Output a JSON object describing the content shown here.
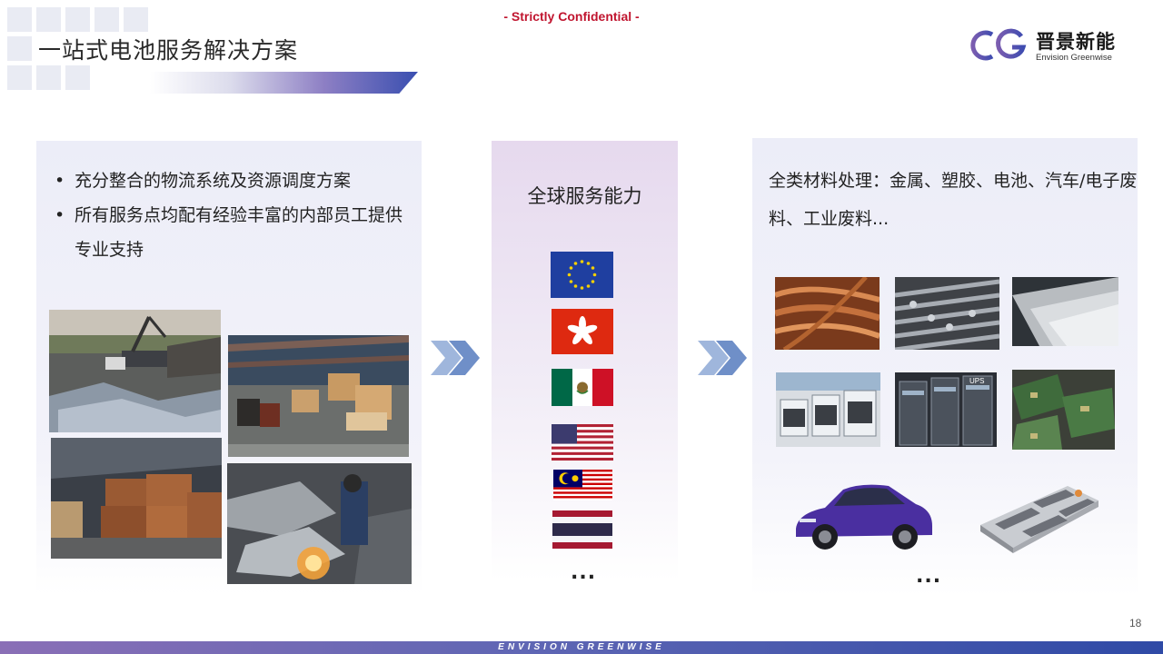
{
  "header": {
    "confidential": "- Strictly Confidential -",
    "title": "一站式电池服务解决方案",
    "logo_cn": "晋景新能",
    "logo_en": "Envision Greenwise"
  },
  "left_panel": {
    "bullets": [
      "充分整合的物流系统及资源调度方案",
      "所有服务点均配有经验丰富的内部员工提供专业支持"
    ],
    "photos": [
      "scrapyard-photo",
      "warehouse-photo",
      "copper-bales-photo",
      "metal-cutting-photo"
    ]
  },
  "middle_panel": {
    "title": "全球服务能力",
    "flags": [
      "eu-flag",
      "hong-kong-flag",
      "mexico-flag",
      "usa-flag",
      "malaysia-flag",
      "thailand-flag"
    ],
    "more": "..."
  },
  "right_panel": {
    "text": "全类材料处理：金属、塑胶、电池、汽车/电子废料、工业废料...",
    "photos": [
      "copper-wire-photo",
      "steel-rods-photo",
      "plastic-pellets-photo",
      "battery-storage-photo",
      "ups-cabinets-photo",
      "circuit-boards-photo",
      "electric-car-photo",
      "battery-pack-photo"
    ],
    "more": "..."
  },
  "footer": {
    "page_number": "18",
    "brand": "ENVISION GREENWISE"
  },
  "colors": {
    "confidential_red": "#c0152f",
    "brand_blue": "#2f4aa6",
    "brand_purple": "#8a6fb6",
    "arrow_blue": "#6f8fc8"
  }
}
